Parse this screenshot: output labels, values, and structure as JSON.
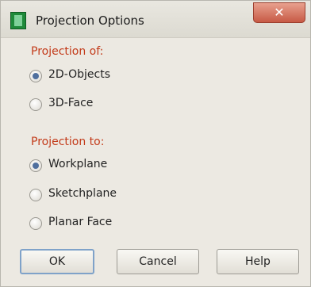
{
  "window": {
    "title": "Projection Options",
    "close_label": "✕"
  },
  "projection_of": {
    "label": "Projection of:",
    "options": [
      {
        "label": "2D-Objects",
        "checked": true
      },
      {
        "label": "3D-Face",
        "checked": false
      }
    ]
  },
  "projection_to": {
    "label": "Projection to:",
    "options": [
      {
        "label": "Workplane",
        "checked": true
      },
      {
        "label": "Sketchplane",
        "checked": false
      },
      {
        "label": "Planar Face",
        "checked": false
      }
    ]
  },
  "buttons": {
    "ok": "OK",
    "cancel": "Cancel",
    "help": "Help"
  },
  "colors": {
    "section_label": "#c33b1a",
    "close_button": "#c75a45",
    "radio_selected": "#4f6f9e",
    "default_button_border": "#7fa2c9"
  }
}
